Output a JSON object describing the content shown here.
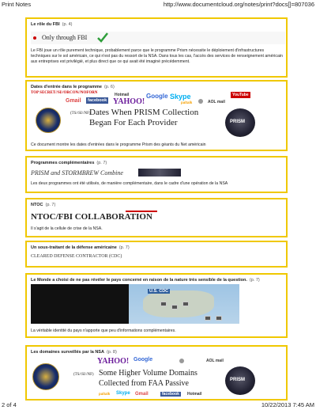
{
  "header": {
    "left": "Print Notes",
    "right": "http://www.documentcloud.org/notes/print?docs[]=807036"
  },
  "footer": {
    "left": "2 of 4",
    "right": "10/22/2013 7:45 AM"
  },
  "notes": [
    {
      "title": "Le rôle du FBI",
      "page": "(p. 4)",
      "excerpt": "Only through FBI",
      "text": "Le FBI joue un rôle purement technique, probablement parce que le programme Prism nécessite le déploiement d'infrastructures techniques sur le sol américain, ce qui n'est pas du ressort de la NSA. Dans tous les cas, l'accès des services de renseignement américain aux entreprises est privilégié, et plus direct que ce qui avait été imaginé précédemment."
    },
    {
      "title": "Dates d'entrée dans le programme",
      "page": "(p. 6)",
      "classification": "TOP SECRET//SI//ORCON//NOFORN",
      "excerpt_line1": "Dates When PRISM Collection",
      "excerpt_line2": "Began For Each Provider",
      "excerpt_marking": "(TS//SI//NF)",
      "logos": [
        "Gmail",
        "facebook",
        "Hotmail",
        "YAHOO!",
        "Google",
        "Skype",
        "paltalk",
        "YouTube",
        "AOL mail"
      ],
      "prism_label": "PRISM",
      "text": "Ce document montre les dates d'entrées dans le programme Prism des géants du Net américain"
    },
    {
      "title": "Programmes complémentaires",
      "page": "(p. 7)",
      "excerpt": "PRISM and STORMBREW Combine",
      "text": "Les deux programmes ont été utilisés, de manière complémentaire, dans le cadre d'une opération de la NSA"
    },
    {
      "title": "NTOC",
      "page": "(p. 7)",
      "excerpt": "NTOC/FBI COLLABORATION",
      "text": "Il s'agit de la cellule de crise de la NSA."
    },
    {
      "title": "Un sous-traitant de la défense américaine",
      "page": "(p. 7)",
      "excerpt": "CLEARED DEFENSE CONTRACTOR (CDC)"
    },
    {
      "title": "Le Monde a choisi de ne pas révéler le pays concerné en raison de la nature très sensible de la question.",
      "page": "(p. 7)",
      "map_label": "U.S. CDC",
      "text": "La véritable identité du pays n'apporte que peu d'informations complémentaires."
    },
    {
      "title": "Les domaines surveillés par la NSA",
      "page": "(p. 8)",
      "excerpt_marking": "(TS//SI//NF)",
      "excerpt_line1": "Some Higher Volume Domains",
      "excerpt_line2": "Collected from FAA Passive",
      "logos": [
        "YAHOO!",
        "Google",
        "AOL mail",
        "Gmail",
        "facebook",
        "Hotmail",
        "paltalk",
        "Skype"
      ],
      "prism_label": "PRISM"
    }
  ],
  "colors": {
    "note_border": "#f0c800",
    "check": "#2e9e3a",
    "classification": "#cc0000"
  }
}
